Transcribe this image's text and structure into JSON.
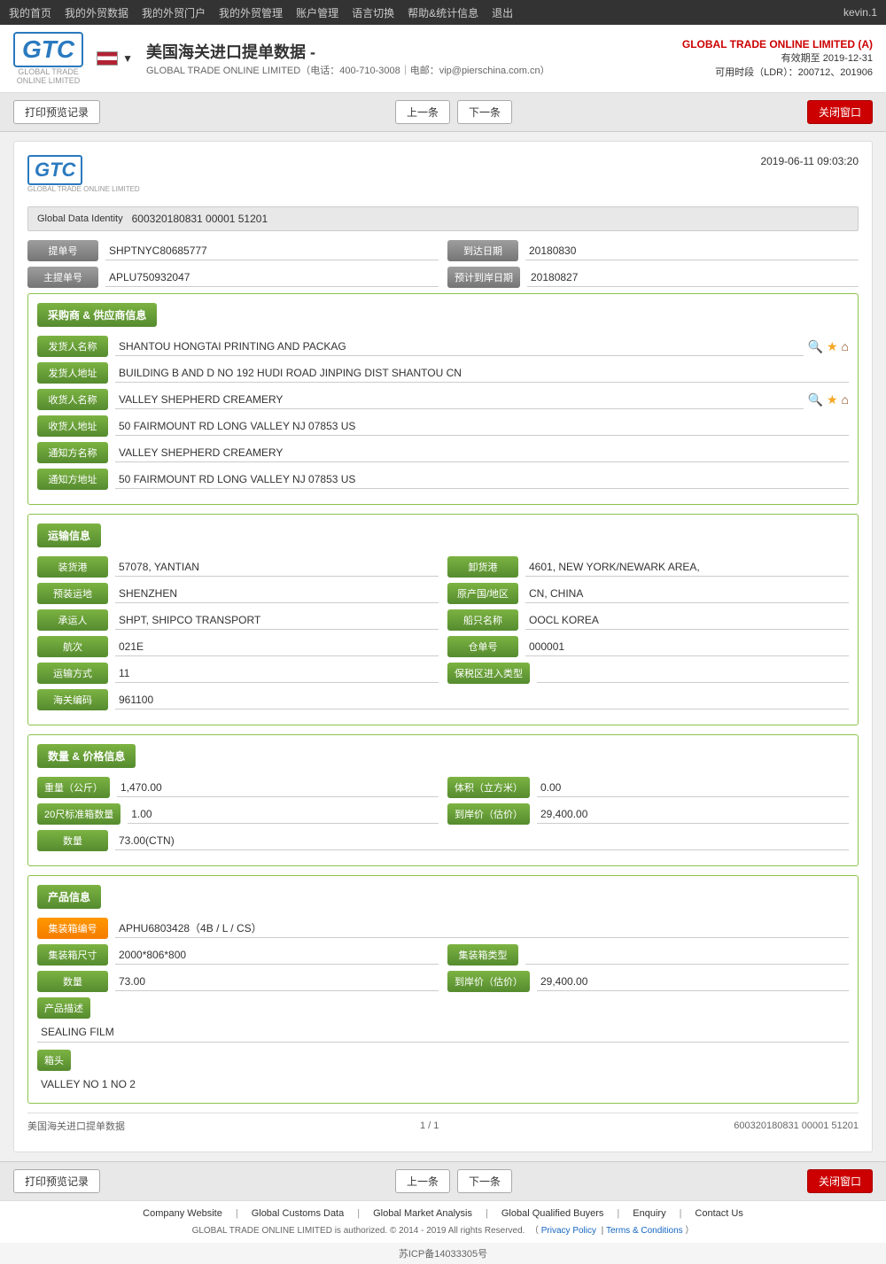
{
  "topnav": {
    "items": [
      "我的首页",
      "我的外贸数据",
      "我的外贸门户",
      "我的外贸管理",
      "账户管理",
      "语言切换",
      "帮助&统计信息",
      "退出"
    ],
    "user": "kevin.1"
  },
  "header": {
    "logo": "GTC",
    "logo_sub": "GLOBAL TRADE\nONLINE LIMITED",
    "page_title": "美国海关进口提单数据",
    "page_subtitle": "GLOBAL TRADE ONLINE LIMITED（电话：400-710-3008｜电邮：vip@pierschina.com.cn）",
    "company": "GLOBAL TRADE ONLINE LIMITED (A)",
    "valid_until": "有效期至 2019-12-31",
    "ldr": "可用时段（LDR）：200712、201906"
  },
  "toolbar": {
    "print_btn": "打印预览记录",
    "prev_btn": "上一条",
    "next_btn": "下一条",
    "close_btn": "关闭窗口"
  },
  "card": {
    "datetime": "2019-06-11 09:03:20",
    "global_data_identity_label": "Global Data Identity",
    "global_data_identity_value": "600320180831 00001 51201",
    "bill_no_label": "提单号",
    "bill_no_value": "SHPTNYC80685777",
    "arrival_date_label": "到达日期",
    "arrival_date_value": "20180830",
    "master_bill_label": "主提单号",
    "master_bill_value": "APLU750932047",
    "estimated_arrival_label": "预计到岸日期",
    "estimated_arrival_value": "20180827"
  },
  "supplier": {
    "section_label": "采购商 & 供应商信息",
    "shipper_name_label": "发货人名称",
    "shipper_name_value": "SHANTOU HONGTAI PRINTING AND PACKAG",
    "shipper_addr_label": "发货人地址",
    "shipper_addr_value": "BUILDING B AND D NO 192 HUDI ROAD JINPING DIST SHANTOU CN",
    "consignee_name_label": "收货人名称",
    "consignee_name_value": "VALLEY SHEPHERD CREAMERY",
    "consignee_addr_label": "收货人地址",
    "consignee_addr_value": "50 FAIRMOUNT RD LONG VALLEY NJ 07853 US",
    "notify_name_label": "通知方名称",
    "notify_name_value": "VALLEY SHEPHERD CREAMERY",
    "notify_addr_label": "通知方地址",
    "notify_addr_value": "50 FAIRMOUNT RD LONG VALLEY NJ 07853 US"
  },
  "transport": {
    "section_label": "运输信息",
    "loading_port_label": "装货港",
    "loading_port_value": "57078, YANTIAN",
    "unloading_port_label": "卸货港",
    "unloading_port_value": "4601, NEW YORK/NEWARK AREA,",
    "pre_dest_label": "预装运地",
    "pre_dest_value": "SHENZHEN",
    "origin_label": "原产国/地区",
    "origin_value": "CN, CHINA",
    "carrier_label": "承运人",
    "carrier_value": "SHPT, SHIPCO TRANSPORT",
    "vessel_label": "船只名称",
    "vessel_value": "OOCL KOREA",
    "voyage_label": "航次",
    "voyage_value": "021E",
    "bill_ref_label": "仓单号",
    "bill_ref_value": "000001",
    "transport_mode_label": "运输方式",
    "transport_mode_value": "11",
    "bonded_label": "保税区进入类型",
    "bonded_value": "",
    "customs_code_label": "海关编码",
    "customs_code_value": "961100"
  },
  "quantity": {
    "section_label": "数量 & 价格信息",
    "weight_label": "重量（公斤）",
    "weight_value": "1,470.00",
    "volume_label": "体积（立方米）",
    "volume_value": "0.00",
    "container20_label": "20尺标准箱数量",
    "container20_value": "1.00",
    "landing_price_label": "到岸价（估价）",
    "landing_price_value": "29,400.00",
    "quantity_label": "数量",
    "quantity_value": "73.00(CTN)"
  },
  "product": {
    "section_label": "产品信息",
    "container_no_label": "集装箱编号",
    "container_no_value": "APHU6803428（4B / L / CS）",
    "container_size_label": "集装箱尺寸",
    "container_size_value": "2000*806*800",
    "container_type_label": "集装箱类型",
    "container_type_value": "",
    "quantity_label": "数量",
    "quantity_value": "73.00",
    "landing_price_label": "到岸价（估价）",
    "landing_price_value": "29,400.00",
    "desc_label": "产品描述",
    "desc_value": "SEALING FILM",
    "mark_label": "箱头",
    "mark_value": "VALLEY NO 1 NO 2"
  },
  "card_footer": {
    "left": "美国海关进口提单数据",
    "center": "1 / 1",
    "right": "600320180831 00001 51201"
  },
  "footer": {
    "links": [
      "Company Website",
      "Global Customs Data",
      "Global Market Analysis",
      "Global Qualified Buyers",
      "Enquiry",
      "Contact Us"
    ],
    "copy": "GLOBAL TRADE ONLINE LIMITED is authorized. © 2014 - 2019 All rights Reserved.",
    "privacy": "Privacy Policy",
    "terms": "Terms & Conditions"
  },
  "icp": "苏ICP备14033305号"
}
